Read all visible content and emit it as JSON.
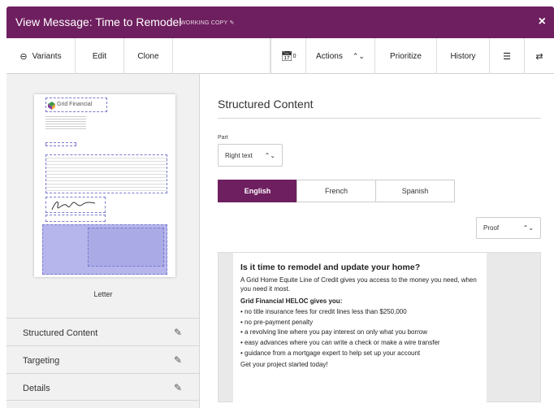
{
  "title": "View Message: Time to Remodel",
  "working_copy": "WORKING COPY",
  "close_glyph": "×",
  "toolbar": {
    "variants": "Variants",
    "edit": "Edit",
    "clone": "Clone",
    "calendar_count": "0",
    "actions": "Actions",
    "prioritize": "Prioritize",
    "history": "History"
  },
  "sidebar": {
    "preview_label": "Letter",
    "logo_text": "Grid Financial",
    "sections": [
      "Structured Content",
      "Targeting",
      "Details"
    ]
  },
  "main": {
    "heading": "Structured Content",
    "part_label": "Part",
    "part_value": "Right text",
    "languages": [
      "English",
      "French",
      "Spanish"
    ],
    "active_language": "English",
    "mode_value": "Proof",
    "content": {
      "question": "Is it time to remodel and update your home?",
      "intro": "A Grid Home Equite Line of Credit gives you access to the money you need, when you need it most.",
      "benefits_heading": "Grid Financial HELOC gives you:",
      "bullets": [
        "• no title insurance fees for credit lines less than $250,000",
        "• no pre-payment penalty",
        "• a revolving line where you pay interest on only what you borrow",
        "• easy advances where you can write a check or make a wire transfer",
        "• guidance from a mortgage expert to help set up your account"
      ],
      "closing": "Get your project started today!"
    }
  },
  "colors": {
    "brand": "#6e1f5f",
    "highlight": "#b6b6ec"
  }
}
